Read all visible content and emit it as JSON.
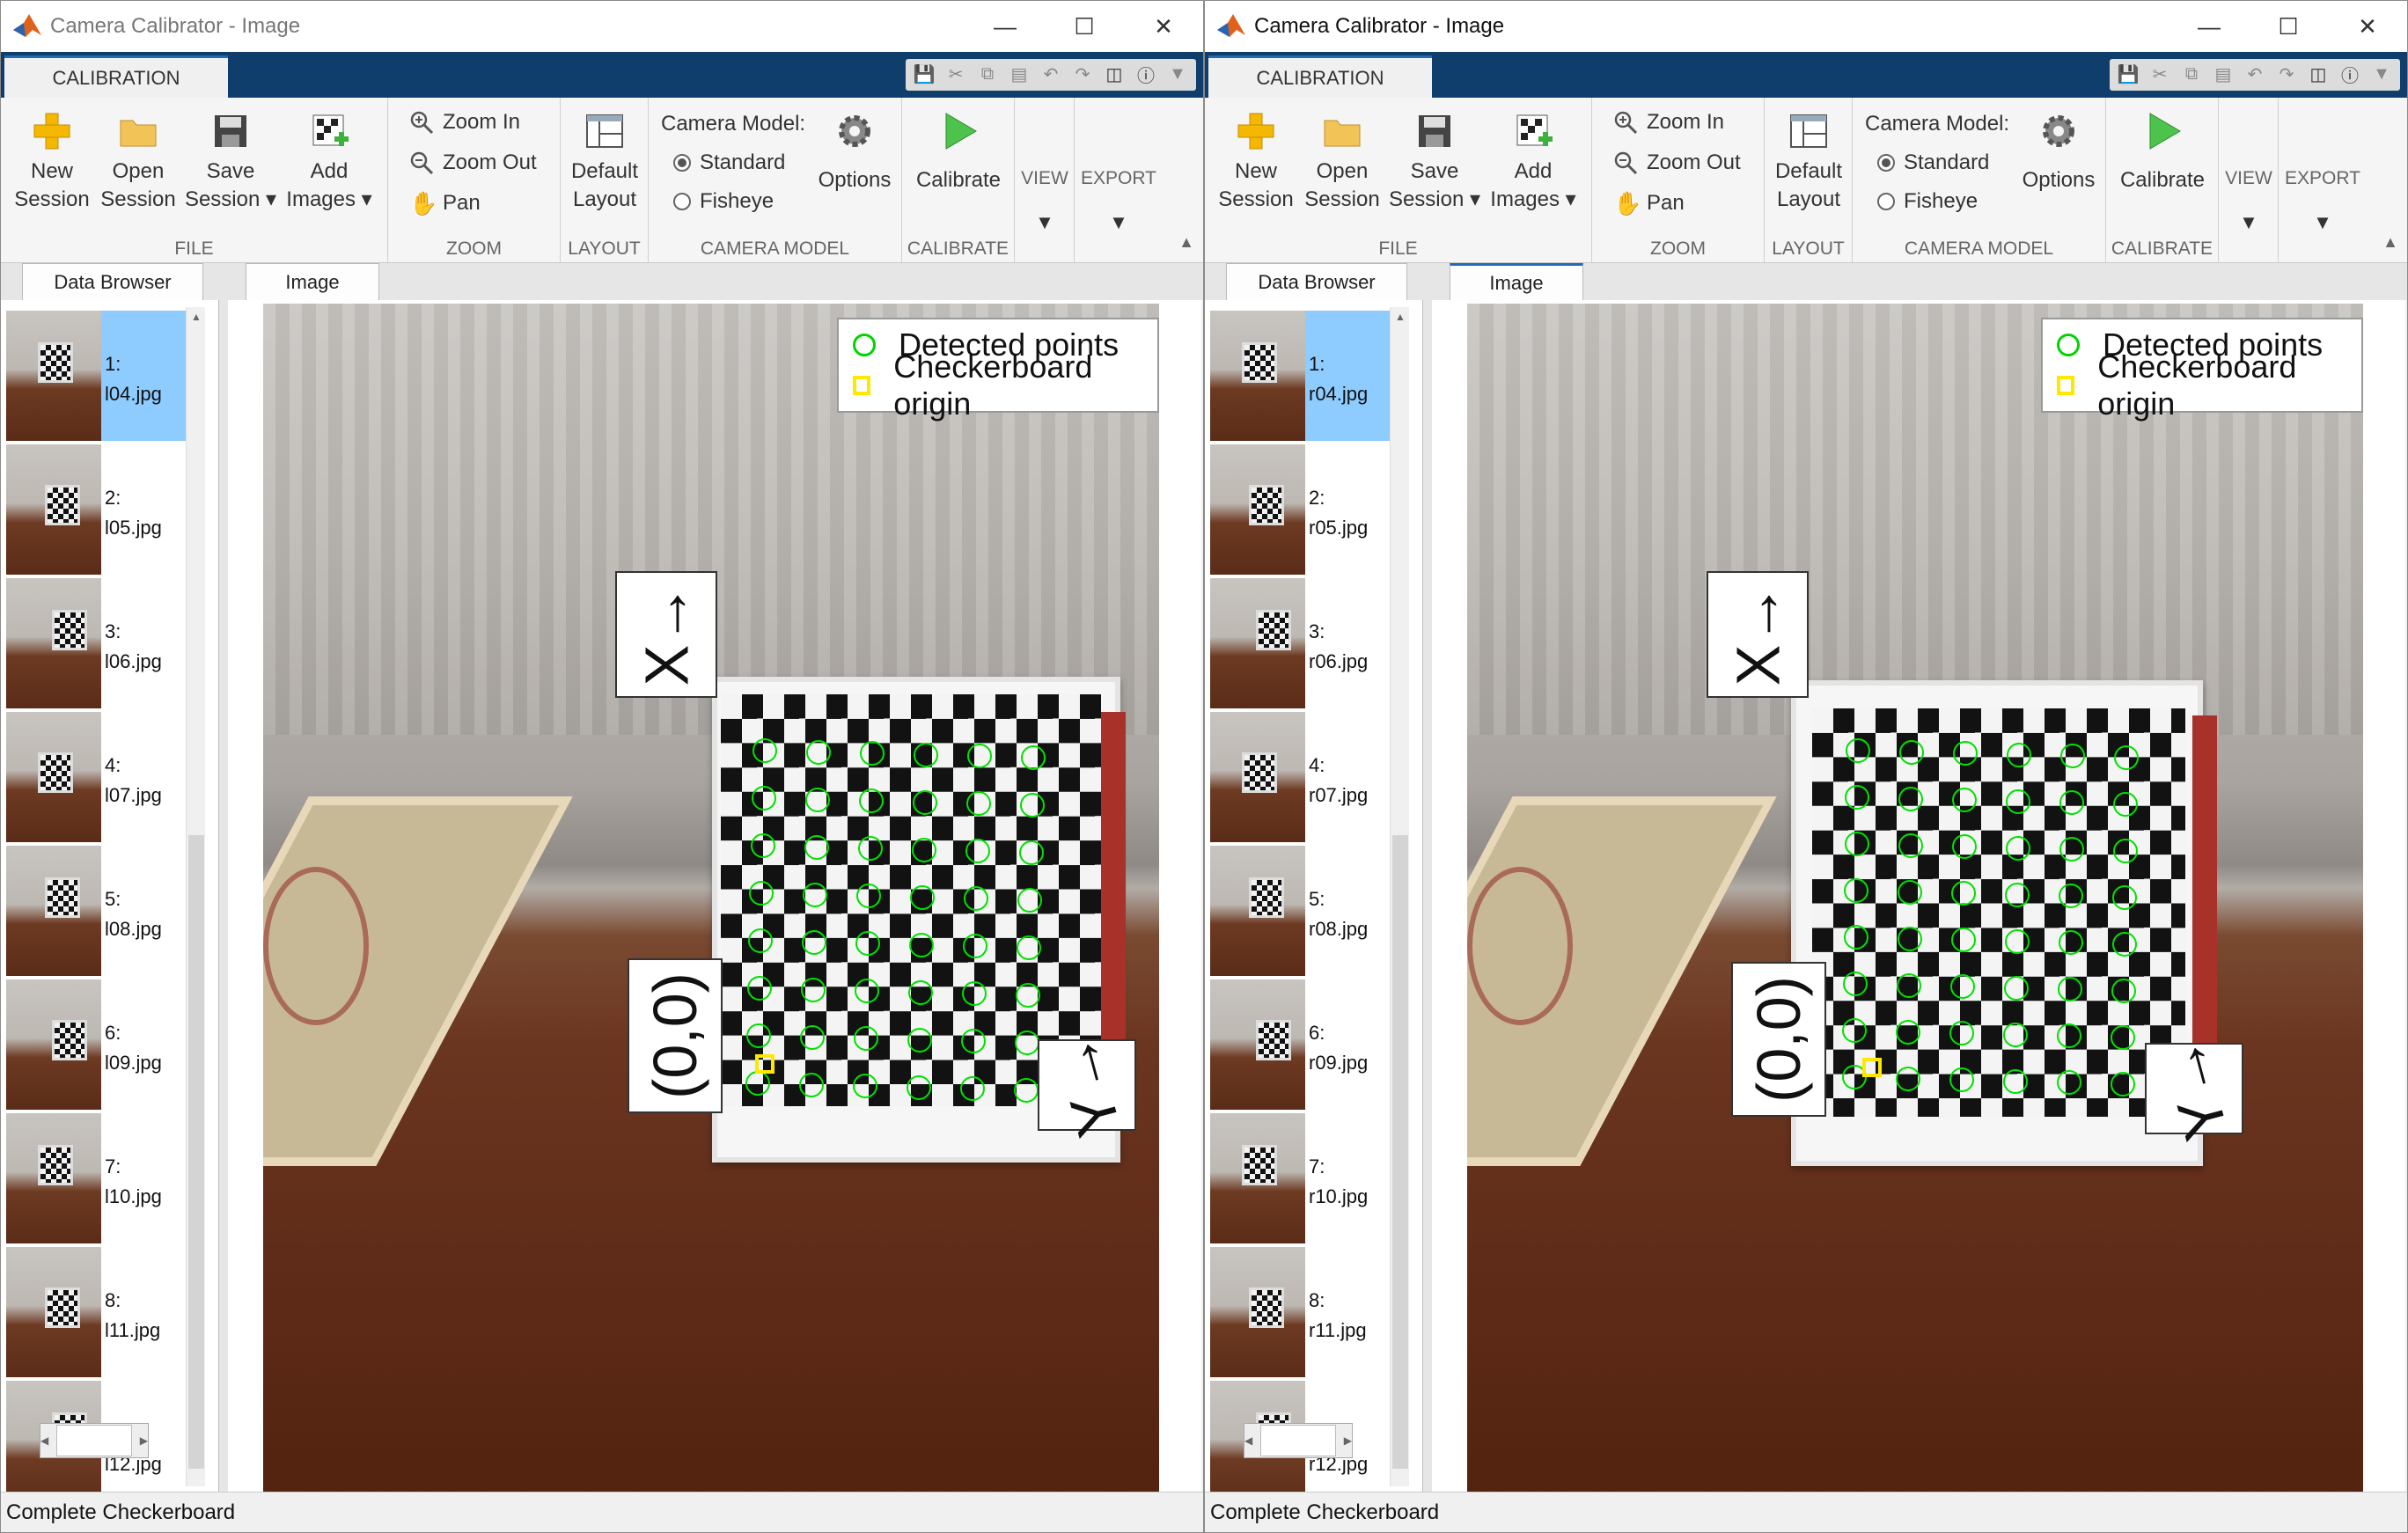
{
  "windows": [
    {
      "id": "left",
      "title": "Camera Calibrator - Image",
      "active": false,
      "ribbon_tab": "CALIBRATION",
      "file": {
        "new_session": "New\nSession",
        "open_session": "Open\nSession",
        "save_session": "Save\nSession",
        "add_images": "Add\nImages",
        "label": "FILE"
      },
      "zoom": {
        "zoom_in": "Zoom In",
        "zoom_out": "Zoom Out",
        "pan": "Pan",
        "label": "ZOOM"
      },
      "layout": {
        "default_layout": "Default\nLayout",
        "label": "LAYOUT"
      },
      "camera_model": {
        "title": "Camera Model:",
        "standard": "Standard",
        "fisheye": "Fisheye",
        "options": "Options",
        "label": "CAMERA MODEL",
        "selected": "Standard"
      },
      "calibrate": {
        "button": "Calibrate",
        "label": "CALIBRATE"
      },
      "view": "VIEW",
      "export": "EXPORT",
      "data_browser_tab": "Data Browser",
      "image_tab": "Image",
      "thumbnails": [
        {
          "index": "1:",
          "file": "l04.jpg",
          "selected": true
        },
        {
          "index": "2:",
          "file": "l05.jpg"
        },
        {
          "index": "3:",
          "file": "l06.jpg"
        },
        {
          "index": "4:",
          "file": "l07.jpg"
        },
        {
          "index": "5:",
          "file": "l08.jpg"
        },
        {
          "index": "6:",
          "file": "l09.jpg"
        },
        {
          "index": "7:",
          "file": "l10.jpg"
        },
        {
          "index": "8:",
          "file": "l11.jpg"
        },
        {
          "index": "9:",
          "file": "l12.jpg"
        }
      ],
      "legend": {
        "detected": "Detected points",
        "origin": "Checkerboard origin"
      },
      "axis_labels": {
        "x": "X→",
        "origin": "(0,0)",
        "y": "Y→"
      },
      "status": "Complete Checkerboard"
    },
    {
      "id": "right",
      "title": "Camera Calibrator - Image",
      "active": true,
      "ribbon_tab": "CALIBRATION",
      "file": {
        "new_session": "New\nSession",
        "open_session": "Open\nSession",
        "save_session": "Save\nSession",
        "add_images": "Add\nImages",
        "label": "FILE"
      },
      "zoom": {
        "zoom_in": "Zoom In",
        "zoom_out": "Zoom Out",
        "pan": "Pan",
        "label": "ZOOM"
      },
      "layout": {
        "default_layout": "Default\nLayout",
        "label": "LAYOUT"
      },
      "camera_model": {
        "title": "Camera Model:",
        "standard": "Standard",
        "fisheye": "Fisheye",
        "options": "Options",
        "label": "CAMERA MODEL",
        "selected": "Standard"
      },
      "calibrate": {
        "button": "Calibrate",
        "label": "CALIBRATE"
      },
      "view": "VIEW",
      "export": "EXPORT",
      "data_browser_tab": "Data Browser",
      "image_tab": "Image",
      "thumbnails": [
        {
          "index": "1:",
          "file": "r04.jpg",
          "selected": true
        },
        {
          "index": "2:",
          "file": "r05.jpg"
        },
        {
          "index": "3:",
          "file": "r06.jpg"
        },
        {
          "index": "4:",
          "file": "r07.jpg"
        },
        {
          "index": "5:",
          "file": "r08.jpg"
        },
        {
          "index": "6:",
          "file": "r09.jpg"
        },
        {
          "index": "7:",
          "file": "r10.jpg"
        },
        {
          "index": "8:",
          "file": "r11.jpg"
        },
        {
          "index": "9:",
          "file": "r12.jpg"
        }
      ],
      "legend": {
        "detected": "Detected points",
        "origin": "Checkerboard origin"
      },
      "axis_labels": {
        "x": "X→",
        "origin": "(0,0)",
        "y": "Y→"
      },
      "status": "Complete Checkerboard"
    }
  ],
  "colors": {
    "tabstrip": "#0f3e6c",
    "detected_point": "#00e000",
    "origin_marker": "#ffe800",
    "selected_thumb": "#8ecbff"
  }
}
